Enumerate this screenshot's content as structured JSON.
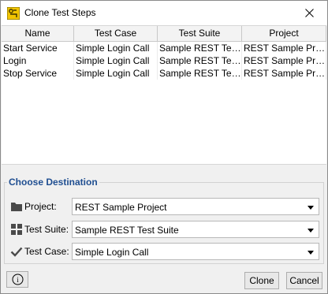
{
  "window": {
    "title": "Clone Test Steps"
  },
  "table": {
    "columns": [
      "Name",
      "Test Case",
      "Test Suite",
      "Project"
    ],
    "rows": [
      [
        "Start Service",
        "Simple Login Call",
        "Sample REST Test ...",
        "REST Sample Proj..."
      ],
      [
        "Login",
        "Simple Login Call",
        "Sample REST Test ...",
        "REST Sample Proj..."
      ],
      [
        "Stop Service",
        "Simple Login Call",
        "Sample REST Test ...",
        "REST Sample Proj..."
      ]
    ]
  },
  "destination": {
    "heading": "Choose Destination",
    "project": {
      "label": "Project:",
      "value": "REST Sample Project",
      "icon": "folder-icon"
    },
    "test_suite": {
      "label": "Test Suite:",
      "value": "Sample REST Test Suite",
      "icon": "grid-icon"
    },
    "test_case": {
      "label": "Test Case:",
      "value": "Simple Login Call",
      "icon": "checkmark-icon"
    }
  },
  "buttons": {
    "clone": "Clone",
    "cancel": "Cancel",
    "info": "i"
  },
  "colors": {
    "heading": "#1f4e91",
    "background": "#f0f0f0"
  }
}
